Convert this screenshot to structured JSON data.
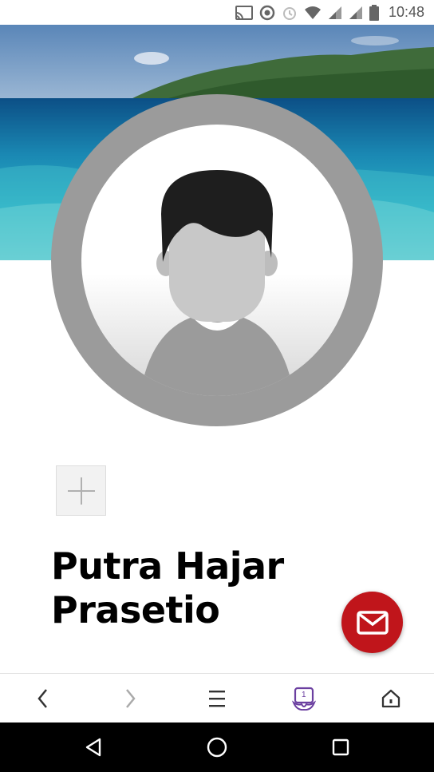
{
  "status_bar": {
    "time": "10:48",
    "icons": [
      "cast-icon",
      "data-saver-icon",
      "alarm-icon",
      "wifi-icon",
      "signal-icon",
      "signal-icon",
      "battery-icon"
    ]
  },
  "profile": {
    "name": "Putra Hajar Prasetio"
  },
  "colors": {
    "fab": "#c0151b",
    "tab_counter": "#6b3fa0",
    "avatar_ring": "#9b9b9b"
  },
  "toolbar": {
    "icons": [
      "back-arrow-icon",
      "forward-arrow-icon",
      "menu-icon",
      "tabs-icon",
      "home-icon"
    ],
    "tab_count": "1"
  },
  "nav": {
    "icons": [
      "back-triangle-icon",
      "home-circle-icon",
      "recents-square-icon"
    ]
  }
}
